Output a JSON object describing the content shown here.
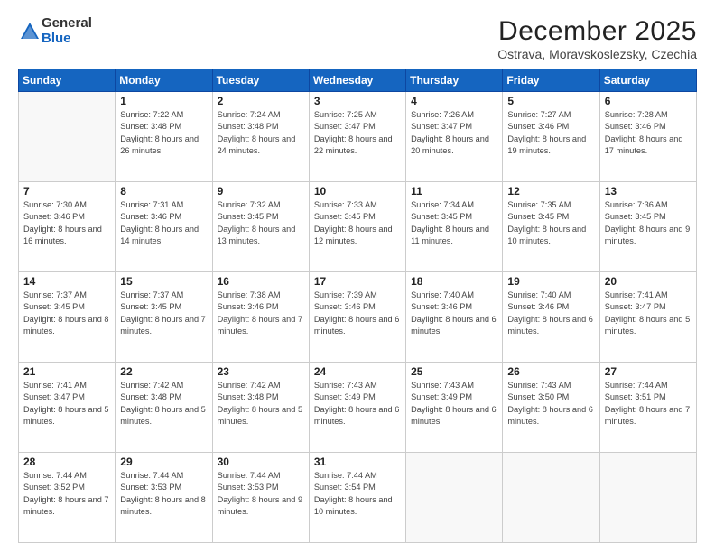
{
  "header": {
    "logo_general": "General",
    "logo_blue": "Blue",
    "month_title": "December 2025",
    "location": "Ostrava, Moravskoslezsky, Czechia"
  },
  "days_of_week": [
    "Sunday",
    "Monday",
    "Tuesday",
    "Wednesday",
    "Thursday",
    "Friday",
    "Saturday"
  ],
  "weeks": [
    [
      {
        "day": "",
        "empty": true
      },
      {
        "day": "1",
        "sunrise": "Sunrise: 7:22 AM",
        "sunset": "Sunset: 3:48 PM",
        "daylight": "Daylight: 8 hours and 26 minutes."
      },
      {
        "day": "2",
        "sunrise": "Sunrise: 7:24 AM",
        "sunset": "Sunset: 3:48 PM",
        "daylight": "Daylight: 8 hours and 24 minutes."
      },
      {
        "day": "3",
        "sunrise": "Sunrise: 7:25 AM",
        "sunset": "Sunset: 3:47 PM",
        "daylight": "Daylight: 8 hours and 22 minutes."
      },
      {
        "day": "4",
        "sunrise": "Sunrise: 7:26 AM",
        "sunset": "Sunset: 3:47 PM",
        "daylight": "Daylight: 8 hours and 20 minutes."
      },
      {
        "day": "5",
        "sunrise": "Sunrise: 7:27 AM",
        "sunset": "Sunset: 3:46 PM",
        "daylight": "Daylight: 8 hours and 19 minutes."
      },
      {
        "day": "6",
        "sunrise": "Sunrise: 7:28 AM",
        "sunset": "Sunset: 3:46 PM",
        "daylight": "Daylight: 8 hours and 17 minutes."
      }
    ],
    [
      {
        "day": "7",
        "sunrise": "Sunrise: 7:30 AM",
        "sunset": "Sunset: 3:46 PM",
        "daylight": "Daylight: 8 hours and 16 minutes."
      },
      {
        "day": "8",
        "sunrise": "Sunrise: 7:31 AM",
        "sunset": "Sunset: 3:46 PM",
        "daylight": "Daylight: 8 hours and 14 minutes."
      },
      {
        "day": "9",
        "sunrise": "Sunrise: 7:32 AM",
        "sunset": "Sunset: 3:45 PM",
        "daylight": "Daylight: 8 hours and 13 minutes."
      },
      {
        "day": "10",
        "sunrise": "Sunrise: 7:33 AM",
        "sunset": "Sunset: 3:45 PM",
        "daylight": "Daylight: 8 hours and 12 minutes."
      },
      {
        "day": "11",
        "sunrise": "Sunrise: 7:34 AM",
        "sunset": "Sunset: 3:45 PM",
        "daylight": "Daylight: 8 hours and 11 minutes."
      },
      {
        "day": "12",
        "sunrise": "Sunrise: 7:35 AM",
        "sunset": "Sunset: 3:45 PM",
        "daylight": "Daylight: 8 hours and 10 minutes."
      },
      {
        "day": "13",
        "sunrise": "Sunrise: 7:36 AM",
        "sunset": "Sunset: 3:45 PM",
        "daylight": "Daylight: 8 hours and 9 minutes."
      }
    ],
    [
      {
        "day": "14",
        "sunrise": "Sunrise: 7:37 AM",
        "sunset": "Sunset: 3:45 PM",
        "daylight": "Daylight: 8 hours and 8 minutes."
      },
      {
        "day": "15",
        "sunrise": "Sunrise: 7:37 AM",
        "sunset": "Sunset: 3:45 PM",
        "daylight": "Daylight: 8 hours and 7 minutes."
      },
      {
        "day": "16",
        "sunrise": "Sunrise: 7:38 AM",
        "sunset": "Sunset: 3:46 PM",
        "daylight": "Daylight: 8 hours and 7 minutes."
      },
      {
        "day": "17",
        "sunrise": "Sunrise: 7:39 AM",
        "sunset": "Sunset: 3:46 PM",
        "daylight": "Daylight: 8 hours and 6 minutes."
      },
      {
        "day": "18",
        "sunrise": "Sunrise: 7:40 AM",
        "sunset": "Sunset: 3:46 PM",
        "daylight": "Daylight: 8 hours and 6 minutes."
      },
      {
        "day": "19",
        "sunrise": "Sunrise: 7:40 AM",
        "sunset": "Sunset: 3:46 PM",
        "daylight": "Daylight: 8 hours and 6 minutes."
      },
      {
        "day": "20",
        "sunrise": "Sunrise: 7:41 AM",
        "sunset": "Sunset: 3:47 PM",
        "daylight": "Daylight: 8 hours and 5 minutes."
      }
    ],
    [
      {
        "day": "21",
        "sunrise": "Sunrise: 7:41 AM",
        "sunset": "Sunset: 3:47 PM",
        "daylight": "Daylight: 8 hours and 5 minutes."
      },
      {
        "day": "22",
        "sunrise": "Sunrise: 7:42 AM",
        "sunset": "Sunset: 3:48 PM",
        "daylight": "Daylight: 8 hours and 5 minutes."
      },
      {
        "day": "23",
        "sunrise": "Sunrise: 7:42 AM",
        "sunset": "Sunset: 3:48 PM",
        "daylight": "Daylight: 8 hours and 5 minutes."
      },
      {
        "day": "24",
        "sunrise": "Sunrise: 7:43 AM",
        "sunset": "Sunset: 3:49 PM",
        "daylight": "Daylight: 8 hours and 6 minutes."
      },
      {
        "day": "25",
        "sunrise": "Sunrise: 7:43 AM",
        "sunset": "Sunset: 3:49 PM",
        "daylight": "Daylight: 8 hours and 6 minutes."
      },
      {
        "day": "26",
        "sunrise": "Sunrise: 7:43 AM",
        "sunset": "Sunset: 3:50 PM",
        "daylight": "Daylight: 8 hours and 6 minutes."
      },
      {
        "day": "27",
        "sunrise": "Sunrise: 7:44 AM",
        "sunset": "Sunset: 3:51 PM",
        "daylight": "Daylight: 8 hours and 7 minutes."
      }
    ],
    [
      {
        "day": "28",
        "sunrise": "Sunrise: 7:44 AM",
        "sunset": "Sunset: 3:52 PM",
        "daylight": "Daylight: 8 hours and 7 minutes."
      },
      {
        "day": "29",
        "sunrise": "Sunrise: 7:44 AM",
        "sunset": "Sunset: 3:53 PM",
        "daylight": "Daylight: 8 hours and 8 minutes."
      },
      {
        "day": "30",
        "sunrise": "Sunrise: 7:44 AM",
        "sunset": "Sunset: 3:53 PM",
        "daylight": "Daylight: 8 hours and 9 minutes."
      },
      {
        "day": "31",
        "sunrise": "Sunrise: 7:44 AM",
        "sunset": "Sunset: 3:54 PM",
        "daylight": "Daylight: 8 hours and 10 minutes."
      },
      {
        "day": "",
        "empty": true
      },
      {
        "day": "",
        "empty": true
      },
      {
        "day": "",
        "empty": true
      }
    ]
  ]
}
